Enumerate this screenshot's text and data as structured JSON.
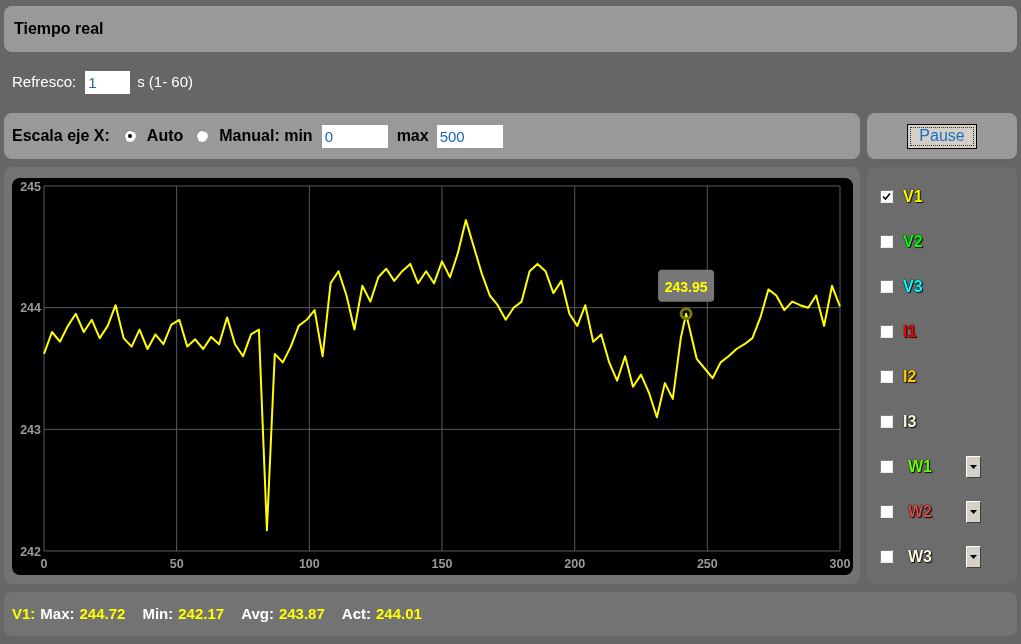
{
  "header": {
    "title": "Tiempo real"
  },
  "refresh": {
    "label": "Refresco:",
    "value": "1",
    "unit": "s (1- 60)"
  },
  "x_scale": {
    "label": "Escala eje X:",
    "options": [
      {
        "label": "Auto",
        "selected": true
      },
      {
        "label": "Manual: min",
        "selected": false
      }
    ],
    "min_value": "0",
    "max_label": "max",
    "max_value": "500"
  },
  "pause_button": "Pause",
  "chart": {
    "chart_data": {
      "type": "line",
      "x": [
        0,
        3,
        6,
        9,
        12,
        15,
        18,
        21,
        24,
        27,
        30,
        33,
        36,
        39,
        42,
        45,
        48,
        51,
        54,
        57,
        60,
        63,
        66,
        69,
        72,
        75,
        78,
        81,
        84,
        87,
        90,
        93,
        96,
        99,
        102,
        105,
        108,
        111,
        114,
        117,
        120,
        123,
        126,
        129,
        132,
        135,
        138,
        141,
        144,
        147,
        150,
        153,
        156,
        159,
        162,
        165,
        168,
        171,
        174,
        177,
        180,
        183,
        186,
        189,
        192,
        195,
        198,
        201,
        204,
        207,
        210,
        213,
        216,
        219,
        222,
        225,
        228,
        231,
        234,
        237,
        240,
        242,
        246,
        249,
        252,
        255,
        258,
        261,
        264,
        267,
        270,
        273,
        276,
        279,
        282,
        285,
        288,
        291,
        294,
        297,
        300
      ],
      "series": [
        {
          "color": "#ffff00",
          "values": [
            243.62,
            243.8,
            243.72,
            243.85,
            243.95,
            243.8,
            243.9,
            243.75,
            243.85,
            244.02,
            243.75,
            243.68,
            243.82,
            243.66,
            243.78,
            243.7,
            243.86,
            243.9,
            243.68,
            243.74,
            243.66,
            243.76,
            243.7,
            243.92,
            243.7,
            243.6,
            243.78,
            243.82,
            242.17,
            243.62,
            243.55,
            243.68,
            243.85,
            243.9,
            243.98,
            243.6,
            244.2,
            244.3,
            244.1,
            243.82,
            244.18,
            244.05,
            244.25,
            244.32,
            244.22,
            244.3,
            244.36,
            244.2,
            244.3,
            244.2,
            244.38,
            244.25,
            244.45,
            244.72,
            244.5,
            244.28,
            244.1,
            244.02,
            243.9,
            244.0,
            244.05,
            244.3,
            244.36,
            244.3,
            244.12,
            244.22,
            243.95,
            243.85,
            244.02,
            243.72,
            243.78,
            243.55,
            243.4,
            243.6,
            243.35,
            243.45,
            243.3,
            243.1,
            243.38,
            243.25,
            243.75,
            243.95,
            243.58,
            243.5,
            243.42,
            243.55,
            243.6,
            243.66,
            243.7,
            243.75,
            243.92,
            244.15,
            244.1,
            243.98,
            244.05,
            244.02,
            244.0,
            244.1,
            243.85,
            244.18,
            244.01
          ]
        }
      ],
      "xlim": [
        0,
        300
      ],
      "ylim": [
        242,
        245
      ],
      "xticks": [
        0,
        50,
        100,
        150,
        200,
        250,
        300
      ],
      "yticks": [
        242,
        243,
        244,
        245
      ],
      "grid": true,
      "annotations": [
        {
          "text": "243.95"
        }
      ]
    }
  },
  "series_list": [
    {
      "label": "V1",
      "color": "#ffff00",
      "checked": true,
      "kind": "plain"
    },
    {
      "label": "V2",
      "color": "#00ff00",
      "checked": false,
      "kind": "plain"
    },
    {
      "label": "V3",
      "color": "#00ffff",
      "checked": false,
      "kind": "plain"
    },
    {
      "label": "I1",
      "color": "#ff0000",
      "checked": false,
      "kind": "plain"
    },
    {
      "label": "I2",
      "color": "#ffcc00",
      "checked": false,
      "kind": "plain"
    },
    {
      "label": "I3",
      "color": "#fff8dc",
      "checked": false,
      "kind": "plain"
    },
    {
      "label": "W1",
      "color": "#66ff00",
      "checked": false,
      "kind": "dropdown"
    },
    {
      "label": "W2",
      "color": "#d84c4c",
      "checked": false,
      "kind": "dropdown"
    },
    {
      "label": "W3",
      "color": "#fff8e0",
      "checked": false,
      "kind": "dropdown"
    }
  ],
  "stats": {
    "series": "V1:",
    "items": [
      {
        "label": "Max:",
        "value": "244.72"
      },
      {
        "label": "Min:",
        "value": "242.17"
      },
      {
        "label": "Avg:",
        "value": "243.87"
      },
      {
        "label": "Act:",
        "value": "244.01"
      }
    ]
  }
}
